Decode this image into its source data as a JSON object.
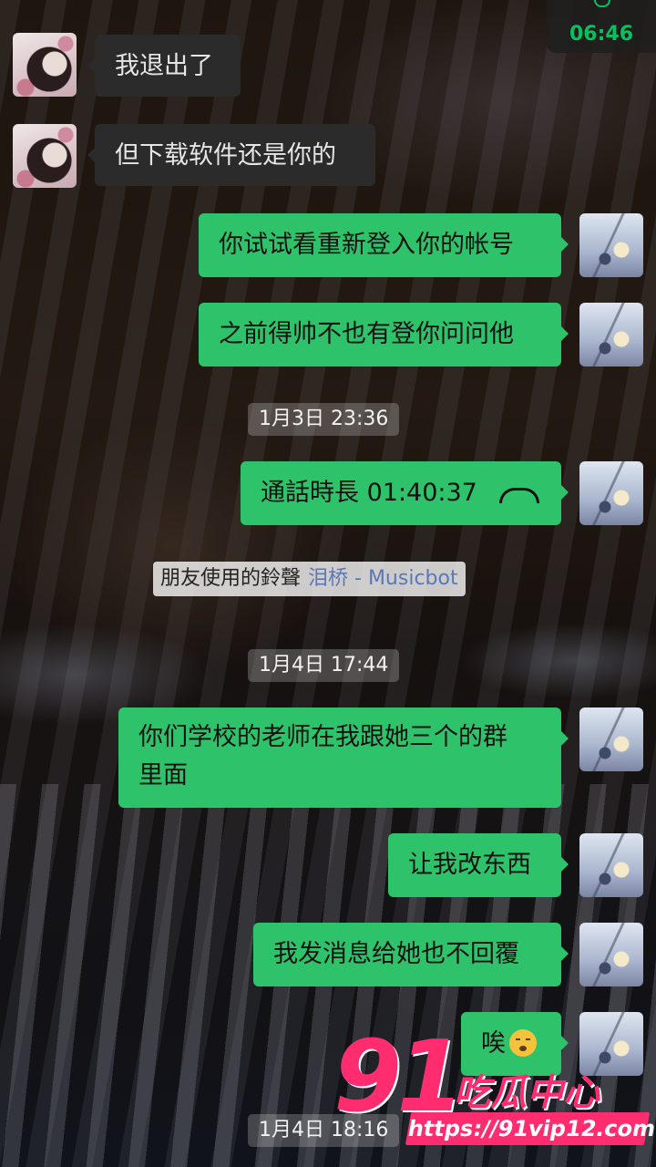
{
  "status": {
    "call_timer": "06:46"
  },
  "messages": [
    {
      "side": "in",
      "text": "我退出了"
    },
    {
      "side": "in",
      "text": "但下载软件还是你的"
    },
    {
      "side": "out",
      "text": "你试试看重新登入你的帐号"
    },
    {
      "side": "out",
      "text": "之前得帅不也有登你问问他"
    },
    {
      "side": "out",
      "call_duration": "通話時長 01:40:37"
    },
    {
      "side": "out",
      "text_line1": "你们学校的老师在我跟她三个的群",
      "text_line2": "里面"
    },
    {
      "side": "out",
      "text": "让我改东西"
    },
    {
      "side": "out",
      "text": "我发消息给她也不回覆"
    },
    {
      "side": "out",
      "text": "唉",
      "emoji": "sad-face-emoji"
    }
  ],
  "timestamps": [
    "1月3日 23:36",
    "1月4日 17:44",
    "1月4日 18:16"
  ],
  "ringtone": {
    "label": "朋友使用的鈴聲",
    "song": "泪桥 - Musicbot"
  },
  "watermark": {
    "number": "91",
    "name": "吃瓜中心",
    "url": "https://91vip12.com"
  },
  "colors": {
    "outgoing_bubble": "#2ec36a",
    "incoming_bubble": "#2b2b2b",
    "accent": "#07c160",
    "watermark": "#ff2d6f"
  },
  "icons": [
    "call-handset-icon",
    "sad-face-emoji"
  ]
}
